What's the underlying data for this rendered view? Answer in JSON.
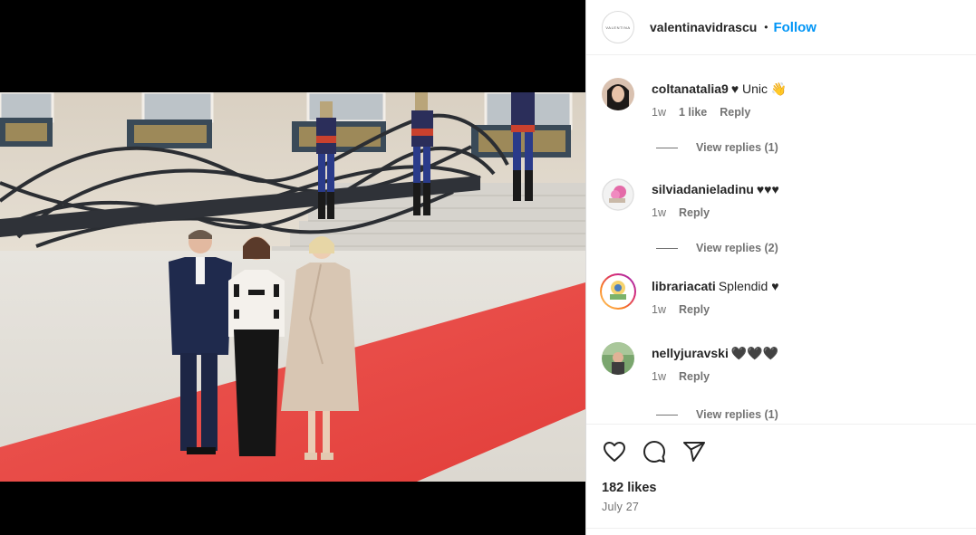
{
  "post": {
    "author": "valentinavidrascu",
    "author_avatar_text": "VALENTINA",
    "separator": "•",
    "follow_label": "Follow",
    "likes": "182 likes",
    "date": "July 27"
  },
  "comments": [
    {
      "user": "coltanatalia9",
      "text": "♥ Unic 👋",
      "time": "1w",
      "likes": "1 like",
      "reply": "Reply",
      "view_replies": "View replies (1)"
    },
    {
      "user": "silviadanieladinu",
      "text": "♥♥♥",
      "time": "1w",
      "likes": "",
      "reply": "Reply",
      "view_replies": "View replies (2)"
    },
    {
      "user": "librariacati",
      "text": "Splendid ♥",
      "time": "1w",
      "likes": "",
      "reply": "Reply",
      "view_replies": ""
    },
    {
      "user": "nellyjuravski",
      "text": "🖤🖤🖤",
      "time": "1w",
      "likes": "",
      "reply": "Reply",
      "view_replies": "View replies (1)"
    }
  ],
  "icons": [
    "heart-icon",
    "comment-icon",
    "share-icon"
  ],
  "colors": {
    "accent": "#0095f6",
    "carpet": "#e8413f",
    "text": "#262626",
    "muted": "#737373"
  }
}
